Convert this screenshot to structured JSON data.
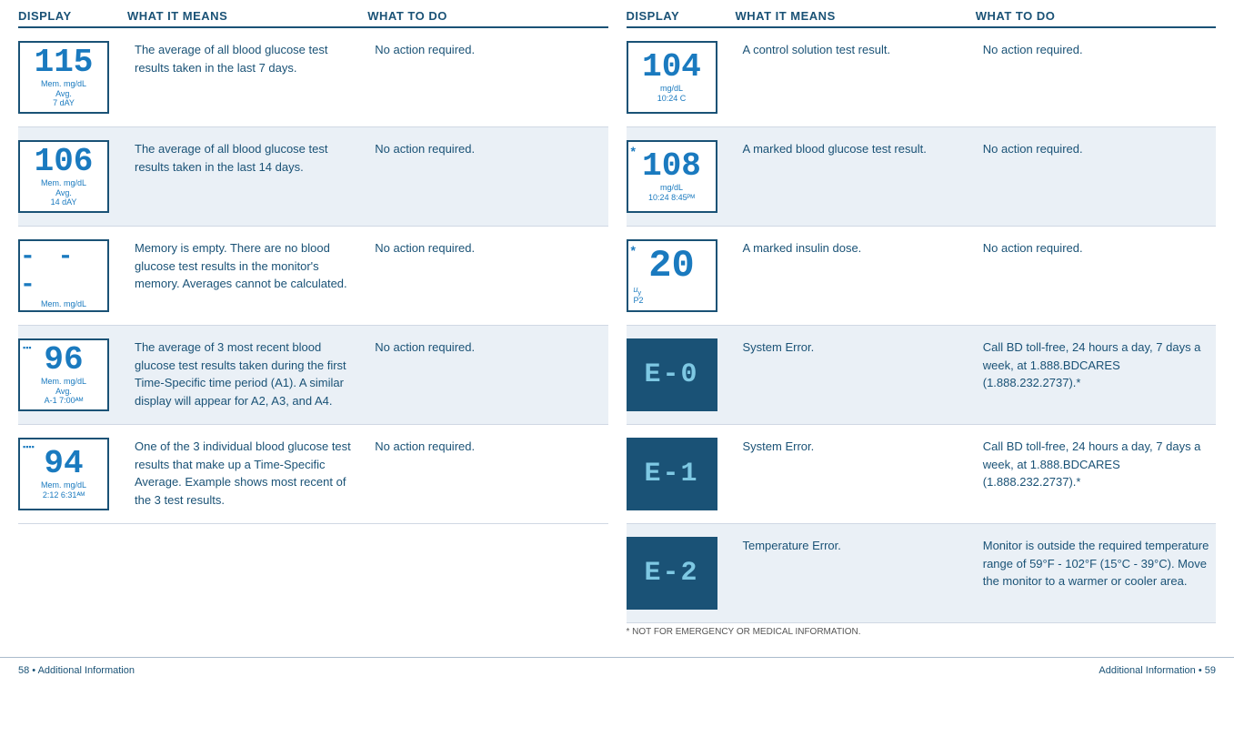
{
  "leftTable": {
    "header": {
      "col1": "DISPLAY",
      "col2": "WHAT IT MEANS",
      "col3": "WHAT TO DO"
    },
    "rows": [
      {
        "displayType": "num115",
        "mainNum": "115",
        "subLabel1": "Mem. mg/dL",
        "subLabel2": "Avg.",
        "subLabel3": "7 dAY",
        "whatItMeans": "The average of all blood glucose test results taken in the last 7 days.",
        "whatToDo": "No action required."
      },
      {
        "displayType": "num106",
        "mainNum": "106",
        "subLabel1": "Mem. mg/dL",
        "subLabel2": "Avg.",
        "subLabel3": "14 dAY",
        "whatItMeans": "The average of all blood glucose test results taken in the last 14 days.",
        "whatToDo": "No action required."
      },
      {
        "displayType": "dashes",
        "mainNum": "- - -",
        "subLabel1": "Mem. mg/dL",
        "whatItMeans": "Memory is empty. There are no blood glucose test results in the monitor's memory. Averages cannot be calculated.",
        "whatToDo": "No action required."
      },
      {
        "displayType": "num96",
        "mainNum": "96",
        "subLabel1": "Mem. mg/dL",
        "subLabel2": "Avg.",
        "subLabel3": "A-1  7:00ᵃᴹ",
        "whatItMeans": "The average of 3 most recent blood glucose test results taken during the first Time-Specific time period (A1). A similar display will appear for A2, A3, and A4.",
        "whatToDo": "No action required."
      },
      {
        "displayType": "num94",
        "mainNum": "94",
        "subLabel1": "Mem. mg/dL",
        "subLabel3": "2:12  6:31ᵃᴹ",
        "whatItMeans": "One of the 3 individual blood glucose test results that make up a Time-Specific Average. Example shows most recent of the 3 test results.",
        "whatToDo": "No action required."
      }
    ]
  },
  "rightTable": {
    "header": {
      "col1": "DISPLAY",
      "col2": "WHAT IT MEANS",
      "col3": "WHAT TO DO"
    },
    "rows": [
      {
        "displayType": "num104",
        "mainNum": "104",
        "subLabel1": "mg/dL",
        "subLabel3": "10:24   C",
        "whatItMeans": "A control solution test result.",
        "whatToDo": "No action required."
      },
      {
        "displayType": "num108_marked",
        "mainNum": "108",
        "subLabel1": "mg/dL",
        "subLabel3": "10:24  8:45ᴘᴹ",
        "whatItMeans": "A marked blood glucose test result.",
        "whatToDo": "No action required."
      },
      {
        "displayType": "num20_marked",
        "mainNum": "20",
        "subLabel3": "P2",
        "whatItMeans": "A marked insulin dose.",
        "whatToDo": "No action required."
      },
      {
        "displayType": "error_E0",
        "mainNum": "E-0",
        "whatItMeans": "System Error.",
        "whatToDo": "Call BD toll-free, 24 hours a day, 7 days a week, at 1.888.BDCARES (1.888.232.2737).*"
      },
      {
        "displayType": "error_E1",
        "mainNum": "E-1",
        "whatItMeans": "System Error.",
        "whatToDo": "Call BD toll-free, 24 hours a day, 7 days a week, at 1.888.BDCARES (1.888.232.2737).*"
      },
      {
        "displayType": "error_E2",
        "mainNum": "E-2",
        "whatItMeans": "Temperature Error.",
        "whatToDo": "Monitor is outside the required temperature range of 59°F - 102°F (15°C - 39°C). Move the monitor to a warmer or cooler area."
      }
    ]
  },
  "footer": {
    "leftPage": "58 • Additional Information",
    "rightPage": "Additional Information • 59",
    "starNote": "* NOT FOR EMERGENCY OR MEDICAL INFORMATION.",
    "additionalInfoLabel": "Additional Information"
  }
}
